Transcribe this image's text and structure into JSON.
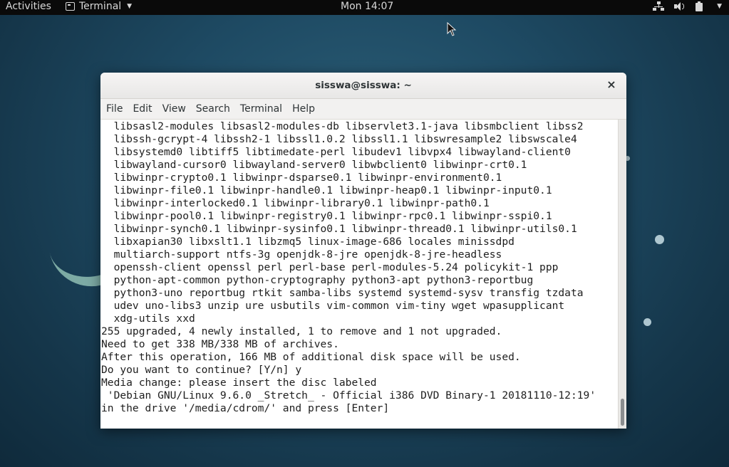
{
  "topbar": {
    "activities": "Activities",
    "app_name": "Terminal",
    "app_icon": "terminal-icon",
    "clock": "Mon 14:07",
    "status_icons": [
      "network-icon",
      "volume-icon",
      "battery-icon",
      "system-menu-caret-icon"
    ]
  },
  "window": {
    "title": "sisswa@sisswa: ~",
    "close_label": "×",
    "menu": [
      "File",
      "Edit",
      "View",
      "Search",
      "Terminal",
      "Help"
    ],
    "lines": [
      "  libsasl2-modules libsasl2-modules-db libservlet3.1-java libsmbclient libss2",
      "  libssh-gcrypt-4 libssh2-1 libssl1.0.2 libssl1.1 libswresample2 libswscale4",
      "  libsystemd0 libtiff5 libtimedate-perl libudev1 libvpx4 libwayland-client0",
      "  libwayland-cursor0 libwayland-server0 libwbclient0 libwinpr-crt0.1",
      "  libwinpr-crypto0.1 libwinpr-dsparse0.1 libwinpr-environment0.1",
      "  libwinpr-file0.1 libwinpr-handle0.1 libwinpr-heap0.1 libwinpr-input0.1",
      "  libwinpr-interlocked0.1 libwinpr-library0.1 libwinpr-path0.1",
      "  libwinpr-pool0.1 libwinpr-registry0.1 libwinpr-rpc0.1 libwinpr-sspi0.1",
      "  libwinpr-synch0.1 libwinpr-sysinfo0.1 libwinpr-thread0.1 libwinpr-utils0.1",
      "  libxapian30 libxslt1.1 libzmq5 linux-image-686 locales minissdpd",
      "  multiarch-support ntfs-3g openjdk-8-jre openjdk-8-jre-headless",
      "  openssh-client openssl perl perl-base perl-modules-5.24 policykit-1 ppp",
      "  python-apt-common python-cryptography python3-apt python3-reportbug",
      "  python3-uno reportbug rtkit samba-libs systemd systemd-sysv transfig tzdata",
      "  udev uno-libs3 unzip ure usbutils vim-common vim-tiny wget wpasupplicant",
      "  xdg-utils xxd",
      "255 upgraded, 4 newly installed, 1 to remove and 1 not upgraded.",
      "Need to get 338 MB/338 MB of archives.",
      "After this operation, 166 MB of additional disk space will be used.",
      "Do you want to continue? [Y/n] y",
      "Media change: please insert the disc labeled",
      " 'Debian GNU/Linux 9.6.0 _Stretch_ - Official i386 DVD Binary-1 20181110-12:19'",
      "in the drive '/media/cdrom/' and press [Enter]"
    ]
  }
}
